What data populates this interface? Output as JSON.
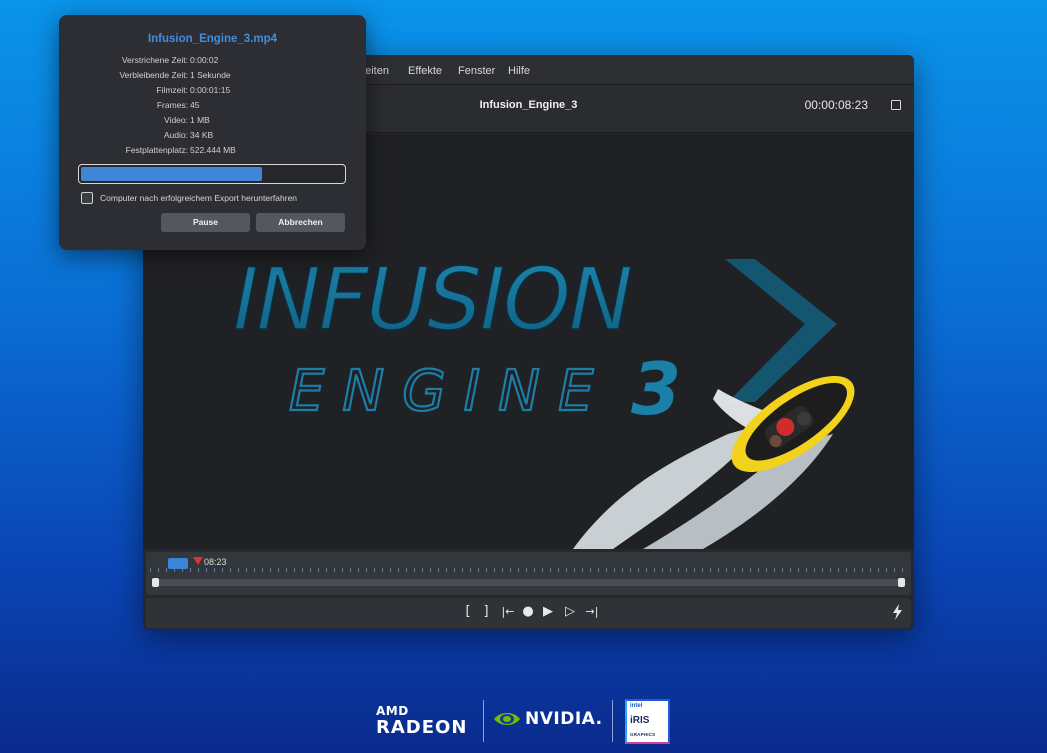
{
  "menu": {
    "items": [
      "beiten",
      "Effekte",
      "Fenster",
      "Hilfe"
    ]
  },
  "editor": {
    "project_title": "Infusion_Engine_3",
    "timecode": "00:00:08:23"
  },
  "preview": {
    "headline": "INFUSION",
    "subline": "ENGINE",
    "number": "3"
  },
  "timeline": {
    "playhead_time": "08:23"
  },
  "transport": {
    "buttons": {
      "mark_in": "[",
      "mark_out": "]",
      "go_start": "|←",
      "globe": "●",
      "play": "▶",
      "step": "▷",
      "go_end": "→|"
    }
  },
  "export_dialog": {
    "title": "Infusion_Engine_3.mp4",
    "stats": [
      {
        "label": "Verstrichene Zeit:",
        "value": "0:00:02"
      },
      {
        "label": "Verbleibende Zeit:",
        "value": "1 Sekunde"
      },
      {
        "label": "Filmzeit:",
        "value": "0:00:01:15"
      },
      {
        "label": "Frames:",
        "value": "45"
      },
      {
        "label": "Video:",
        "value": "1 MB"
      },
      {
        "label": "Audio:",
        "value": "34 KB"
      },
      {
        "label": "Festplattenplatz:",
        "value": "522.444 MB"
      }
    ],
    "progress_fraction": 0.69,
    "shutdown_checkbox_label": "Computer nach erfolgreichem Export herunterfahren",
    "shutdown_checked": false,
    "pause_label": "Pause",
    "cancel_label": "Abbrechen"
  },
  "logos": {
    "amd_line1": "AMD",
    "amd_line2": "RADEON",
    "nvidia": "NVIDIA.",
    "intel": "intel",
    "iris": "iRIS",
    "iris_sub": "GRAPHICS"
  },
  "colors": {
    "accent": "#3f86d6",
    "title_blue": "#3f8fe0",
    "playhead": "#e0322f",
    "logo_cyan": "#1a7fa8",
    "jetski_yellow": "#f2d21b"
  }
}
